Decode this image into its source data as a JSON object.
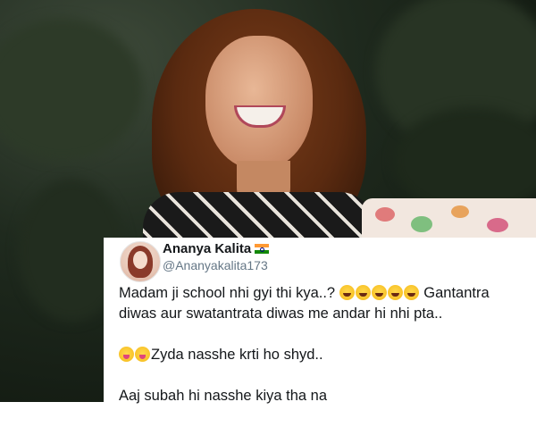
{
  "photo": {
    "description_icon": "photo-background"
  },
  "tweet": {
    "author_name": "Ananya Kalita",
    "author_flag_icon": "india-flag-icon",
    "handle": "@Ananyakalita173",
    "line1_prefix": "Madam ji school nhi gyi thi kya..? ",
    "line1_emoji_count": 5,
    "line1_suffix": " Gantantra diwas aur swatantrata diwas me andar hi nhi pta..",
    "line2_suffix": "Zyda nasshe krti ho shyd..",
    "line3": "Aaj subah hi nasshe kiya tha na"
  },
  "colors": {
    "name": "#14171a",
    "handle": "#657786"
  }
}
